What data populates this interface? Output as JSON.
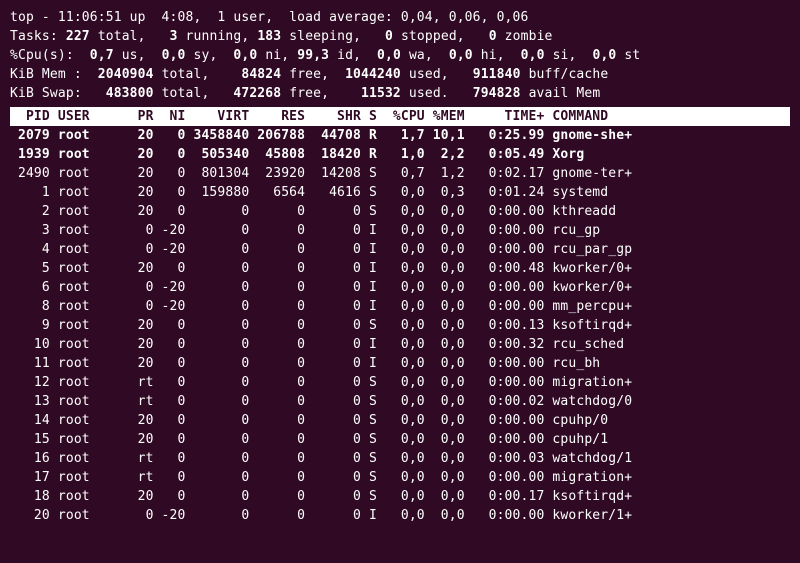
{
  "summary": {
    "l1": "top - 11:06:51 up  4:08,  1 user,  load average: 0,04, 0,06, 0,06",
    "l2a": "Tasks: ",
    "l2b": "227 ",
    "l2c": "total,   ",
    "l2d": "3 ",
    "l2e": "running, ",
    "l2f": "183 ",
    "l2g": "sleeping,   ",
    "l2h": "0 ",
    "l2i": "stopped,   ",
    "l2j": "0 ",
    "l2k": "zombie",
    "l3a": "%Cpu(s):  ",
    "l3b": "0,7 ",
    "l3c": "us,  ",
    "l3d": "0,0 ",
    "l3e": "sy,  ",
    "l3f": "0,0 ",
    "l3g": "ni, ",
    "l3h": "99,3 ",
    "l3i": "id,  ",
    "l3j": "0,0 ",
    "l3k": "wa,  ",
    "l3l": "0,0 ",
    "l3m": "hi,  ",
    "l3n": "0,0 ",
    "l3o": "si,  ",
    "l3p": "0,0 ",
    "l3q": "st",
    "l4a": "KiB Mem : ",
    "l4b": " 2040904 ",
    "l4c": "total,   ",
    "l4d": " 84824 ",
    "l4e": "free,  ",
    "l4f": "1044240 ",
    "l4g": "used,   ",
    "l4h": "911840 ",
    "l4i": "buff/cache",
    "l5a": "KiB Swap:  ",
    "l5b": " 483800 ",
    "l5c": "total,   ",
    "l5d": "472268 ",
    "l5e": "free,    ",
    "l5f": "11532 ",
    "l5g": "used.   ",
    "l5h": "794828 ",
    "l5i": "avail Mem"
  },
  "header": "  PID USER      PR  NI    VIRT    RES    SHR S  %CPU %MEM     TIME+ COMMAND   ",
  "rows": [
    {
      "b": true,
      "t": " 2079 root      20   0 3458840 206788  44708 R   1,7 10,1   0:25.99 gnome-she+"
    },
    {
      "b": true,
      "t": " 1939 root      20   0  505340  45808  18420 R   1,0  2,2   0:05.49 Xorg      "
    },
    {
      "b": false,
      "t": " 2490 root      20   0  801304  23920  14208 S   0,7  1,2   0:02.17 gnome-ter+"
    },
    {
      "b": false,
      "t": "    1 root      20   0  159880   6564   4616 S   0,0  0,3   0:01.24 systemd   "
    },
    {
      "b": false,
      "t": "    2 root      20   0       0      0      0 S   0,0  0,0   0:00.00 kthreadd  "
    },
    {
      "b": false,
      "t": "    3 root       0 -20       0      0      0 I   0,0  0,0   0:00.00 rcu_gp    "
    },
    {
      "b": false,
      "t": "    4 root       0 -20       0      0      0 I   0,0  0,0   0:00.00 rcu_par_gp"
    },
    {
      "b": false,
      "t": "    5 root      20   0       0      0      0 I   0,0  0,0   0:00.48 kworker/0+"
    },
    {
      "b": false,
      "t": "    6 root       0 -20       0      0      0 I   0,0  0,0   0:00.00 kworker/0+"
    },
    {
      "b": false,
      "t": "    8 root       0 -20       0      0      0 I   0,0  0,0   0:00.00 mm_percpu+"
    },
    {
      "b": false,
      "t": "    9 root      20   0       0      0      0 S   0,0  0,0   0:00.13 ksoftirqd+"
    },
    {
      "b": false,
      "t": "   10 root      20   0       0      0      0 I   0,0  0,0   0:00.32 rcu_sched "
    },
    {
      "b": false,
      "t": "   11 root      20   0       0      0      0 I   0,0  0,0   0:00.00 rcu_bh    "
    },
    {
      "b": false,
      "t": "   12 root      rt   0       0      0      0 S   0,0  0,0   0:00.00 migration+"
    },
    {
      "b": false,
      "t": "   13 root      rt   0       0      0      0 S   0,0  0,0   0:00.02 watchdog/0"
    },
    {
      "b": false,
      "t": "   14 root      20   0       0      0      0 S   0,0  0,0   0:00.00 cpuhp/0   "
    },
    {
      "b": false,
      "t": "   15 root      20   0       0      0      0 S   0,0  0,0   0:00.00 cpuhp/1   "
    },
    {
      "b": false,
      "t": "   16 root      rt   0       0      0      0 S   0,0  0,0   0:00.03 watchdog/1"
    },
    {
      "b": false,
      "t": "   17 root      rt   0       0      0      0 S   0,0  0,0   0:00.00 migration+"
    },
    {
      "b": false,
      "t": "   18 root      20   0       0      0      0 S   0,0  0,0   0:00.17 ksoftirqd+"
    },
    {
      "b": false,
      "t": "   20 root       0 -20       0      0      0 I   0,0  0,0   0:00.00 kworker/1+"
    }
  ]
}
